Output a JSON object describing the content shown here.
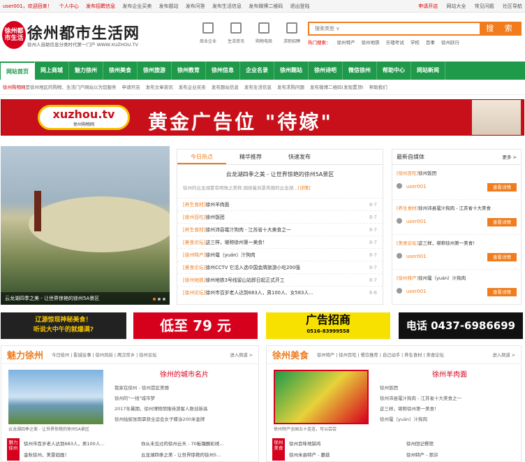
{
  "topbar": {
    "user": "user001，欢迎回来！",
    "center": "个人中心",
    "post_info": "发布招聘信息",
    "items": [
      "发布企业买卖",
      "发布题站",
      "发布问答",
      "发布生活信息",
      "发布微博二维码",
      "退出登陆"
    ],
    "right": [
      "申请开店",
      "网站大全",
      "常见问题",
      "社区导航"
    ]
  },
  "logo": {
    "seal": "徐州都市生活",
    "title": "徐州都市生活网",
    "slogan": "徐州人自助信息分类时代第一门户 WWW.XUZHOU.TV"
  },
  "header_icons": [
    {
      "label": "商业企业",
      "icon": "building-icon"
    },
    {
      "label": "生活资讯",
      "icon": "info-icon"
    },
    {
      "label": "购物电商",
      "icon": "shop-icon"
    },
    {
      "label": "求职招聘",
      "icon": "briefcase-icon"
    }
  ],
  "search": {
    "placeholder": "搜索类型 ∨",
    "button": "搜 索",
    "hot_label": "热门搜索：",
    "hot": [
      "徐州特产",
      "徐州地铁",
      "乐理考试",
      "学校",
      "百事",
      "徐州跃行"
    ]
  },
  "nav": [
    "网站首页",
    "网上商城",
    "魅力徐州",
    "徐州美食",
    "徐州旅游",
    "徐州教育",
    "徐州信息",
    "企业名录",
    "徐州题站",
    "徐州诗吧",
    "微信徐州",
    "帮助中心",
    "网站新闻"
  ],
  "notice": {
    "prefix": "徐州购物网",
    "text": "是徐州地区的购物、生活门户网站以为您服务",
    "links": [
      "申请开店",
      "发布文章资讯",
      "发布企业买卖",
      "发布题站信息",
      "发布生活信息",
      "发布求购问题",
      "发布微博二维码(发现置顶)",
      "帮助我们"
    ]
  },
  "banner": {
    "brand": "xuzhou.tv",
    "brand_sub": "徐州购物网",
    "text": "黄金广告位  \"待嫁\""
  },
  "feature": {
    "caption": "云龙湖四季之美 - 让世界惊艳的徐州5A景区"
  },
  "news": {
    "tabs": [
      "今日热点",
      "精华推荐",
      "快速发布"
    ],
    "headline": "云龙湖四季之美 - 让世界惊艳的徐州5A景区",
    "summary": "徐州的云龙湖素有明珠之美称,围绕着风景秀丽的云龙湖…",
    "detail": "[详情]",
    "items": [
      {
        "cat": "[养生食材]",
        "title": "徐州羊肉面",
        "date": "8-7"
      },
      {
        "cat": "[徐州百吃]",
        "title": "徐州饭团",
        "date": "8-7"
      },
      {
        "cat": "[养生食材]",
        "title": "徐州沛县鼋汁狗肉 - 江苏省十大美食之一",
        "date": "8-7"
      },
      {
        "cat": "[美食论坛]",
        "title": "这三样，堪称徐州第一美食！",
        "date": "8-7"
      },
      {
        "cat": "[徐州特产]",
        "title": "徐州鼋（yuán）汁狗肉",
        "date": "8-7"
      },
      {
        "cat": "[美食论坛]",
        "title": "徐州CCTV 它活入选中国金牌旅游小吃200强",
        "date": "8-7"
      },
      {
        "cat": "[徐州地铁]",
        "title": "徐州地铁3号线留山站即日起正式开工",
        "date": "8-7"
      },
      {
        "cat": "[徐州论坛]",
        "title": "徐州市百岁老人达到683人，男100人、女583人…",
        "date": "8-6"
      }
    ]
  },
  "media": {
    "title": "最新自媒体",
    "more": "更多 >",
    "view": "查看详情",
    "items": [
      {
        "cat": "[徐州百吃]",
        "title": "徐州饭团",
        "user": "user001"
      },
      {
        "cat": "[养生食材]",
        "title": "徐州沛县鼋汁狗肉 - 江苏省十大美食",
        "user": "user001"
      },
      {
        "cat": "[美食论坛]",
        "title": "这三样，堪称徐州第一美食！",
        "user": "user001"
      },
      {
        "cat": "[徐州特产]",
        "title": "徐州鼋（yuán）汁狗肉",
        "user": "user001"
      }
    ]
  },
  "ads": {
    "a1_line1": "辽源惊现神秘美食！",
    "a1_line2": "听说大中午的就爆满?",
    "a2": "低至 79 元",
    "a3": "广告招商",
    "a3_phone": "0516-83999558",
    "a4": "电话 0437-6986699"
  },
  "section1": {
    "title": "魅力徐州",
    "links": "今日徐州 | 影城往事 | 徐州风俗 | 两汉帝乡 | 徐州论坛",
    "more": "进入频道 >",
    "img_caption": "云龙湖四季之美 - 让世界惊艳的徐州5A景区",
    "head": "徐州的城市名片",
    "lines": [
      "我家在徐州 - 徐州首区美丽",
      "徐州的\"一线\"城市梦",
      "2017年暑期，徐州博物馆隆待游客人数创新高",
      "徐州姑娘张雨霏获全运会女子蝶泳200米金牌"
    ],
    "tag": "魅力徐州",
    "bottom": [
      "徐州市百岁老人达到683人，男100人…",
      "你从未见过的徐州云天 - 70板镯酮彩绣…",
      "金秋徐州，美景如画！",
      "云龙湖四季之美 - 让世界惊艳的徐州5…"
    ]
  },
  "section2": {
    "title": "徐州美食",
    "links": "徐州特产 | 徐州百吃 | 餐饮推荐 | 自己动手 | 养生食材 | 美食论坛",
    "more": "进入频道 >",
    "img_caption": "徐州特产全国五十连连，可以尝尝",
    "head": "徐州羊肉面",
    "lines": [
      "徐州饭团",
      "徐州沛县鼋汁狗肉 - 江苏省十大美食之一",
      "这三样，堪称徐州第一美食！",
      "徐州鼋（yuán）汁狗肉"
    ],
    "tag": "徐州美食",
    "bottom": [
      "徐州百味地锅鸡",
      "徐州回记餐馆",
      "徐州米县特产 - 蘑菇",
      "徐州特产 - 邳浒"
    ]
  }
}
